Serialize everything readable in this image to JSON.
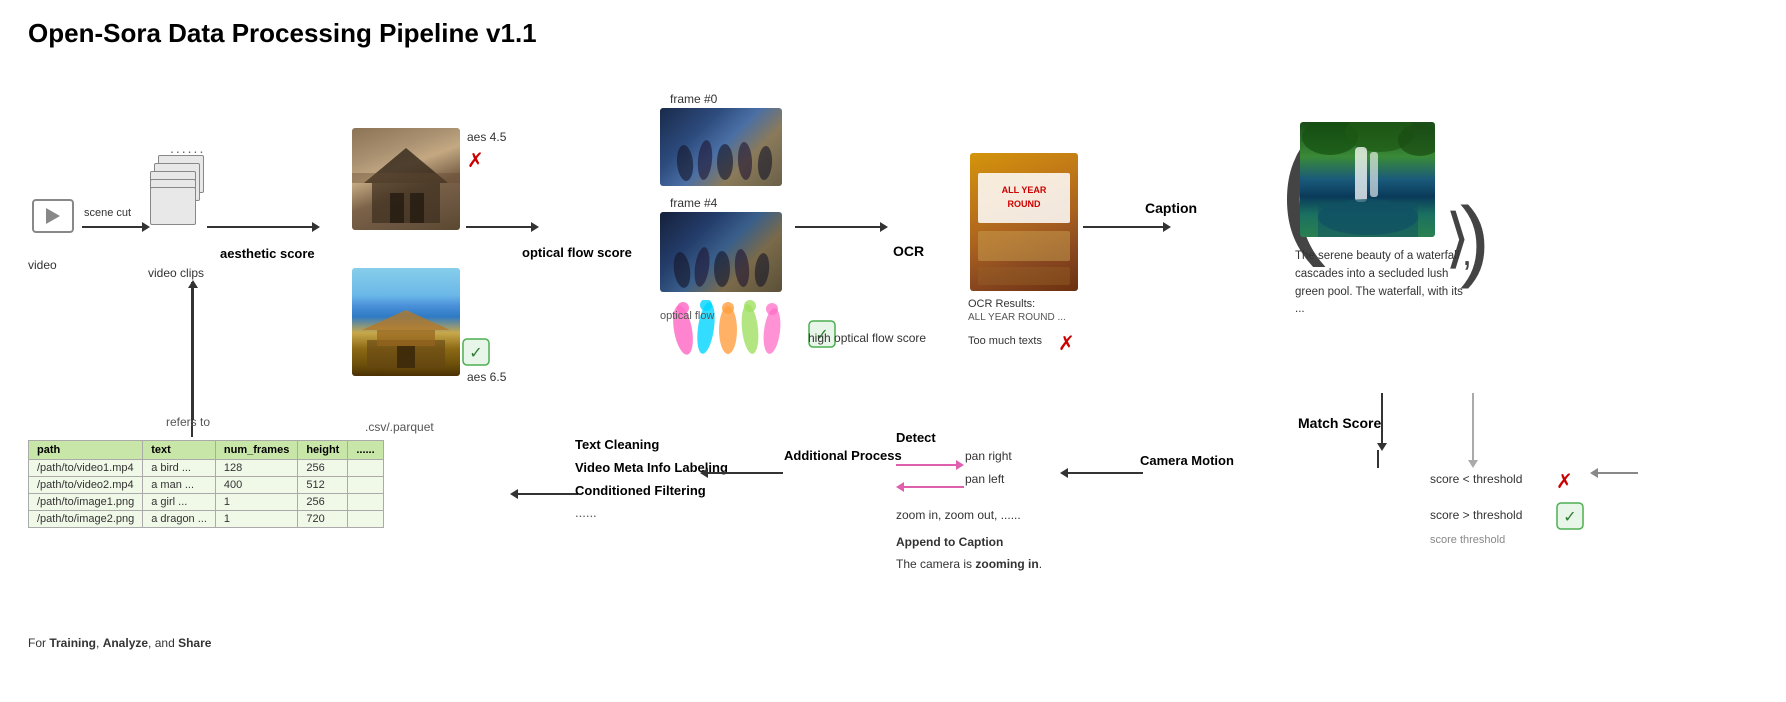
{
  "title": "Open-Sora Data Processing Pipeline v1.1",
  "pipeline": {
    "stage_video": {
      "label": "video",
      "clips_label": "video clips",
      "dots": "......"
    },
    "arrow_scene_cut": {
      "label": "scene cut"
    },
    "stage_aesthetic": {
      "label": "aesthetic score",
      "bad_score": "aes 4.5",
      "good_score": "aes 6.5"
    },
    "stage_optical_flow": {
      "label": "optical flow score",
      "frame0": "frame #0",
      "frame4": "frame #4",
      "high_label": "high optical\nflow score",
      "optical_flow_label": "optical flow"
    },
    "stage_ocr": {
      "label": "OCR",
      "results_label": "OCR Results:",
      "results_text": "ALL YEAR ROUND ...",
      "too_much": "Too much texts"
    },
    "stage_caption": {
      "label": "Caption",
      "text": "The serene beauty of a waterfall cascades into a secluded lush green pool. The waterfall, with its ..."
    },
    "stage_match": {
      "label": "Match Score",
      "bad_label": "score < threshold",
      "good_label": "score > threshold",
      "threshold_note": "score threshold"
    },
    "csv_label": ".csv/.parquet",
    "refers_to": "refers to",
    "table": {
      "headers": [
        "path",
        "text",
        "num_frames",
        "height",
        "......"
      ],
      "rows": [
        [
          "/path/to/video1.mp4",
          "a bird ...",
          "128",
          "256",
          ""
        ],
        [
          "/path/to/video2.mp4",
          "a man ...",
          "400",
          "512",
          ""
        ],
        [
          "/path/to/image1.png",
          "a girl ...",
          "1",
          "256",
          ""
        ],
        [
          "/path/to/image2.png",
          "a dragon ...",
          "1",
          "720",
          ""
        ]
      ]
    },
    "training_label": "For Training, Analyze, and Share",
    "additional": {
      "label": "Additional Process",
      "text_cleaning": "Text Cleaning",
      "video_meta": "Video Meta Info Labeling",
      "cond_filter": "Conditioned Filtering",
      "dots": "......"
    },
    "camera_motion": {
      "label": "Camera Motion",
      "detect": "Detect",
      "pan_right": "pan right",
      "pan_left": "pan left",
      "zoom": "zoom in, zoom out, ......",
      "append_label": "Append to Caption",
      "append_text": "The camera is zooming in."
    }
  },
  "icons": {
    "cross": "✕",
    "check": "✓",
    "cross_red": "✗",
    "check_green": "✓"
  }
}
